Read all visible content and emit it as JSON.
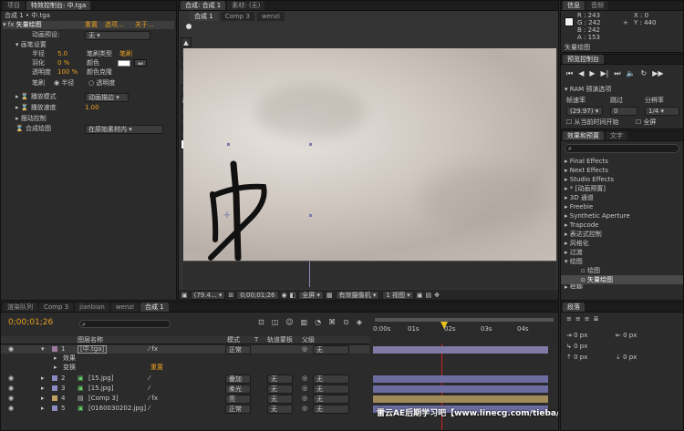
{
  "effect_controls": {
    "tabs": [
      "项目",
      "特效控制台: 中.tga"
    ],
    "header": "合成 1 • 中.tga",
    "effect_name": "矢量绘图",
    "header_buttons": [
      "重置",
      "选项...",
      "关于..."
    ],
    "preset_label": "动画预设:",
    "preset_value": "无",
    "group_brush": "画笔设置",
    "radius_label": "半径",
    "radius_value": "5.0",
    "feather_label": "羽化",
    "feather_value": "0 %",
    "opacity_label": "透明度",
    "opacity_value": "100 %",
    "brush_type_label": "笔刷类型",
    "brush_type_value": "笔刷",
    "color_label": "颜色",
    "color_clone_label": "颜色克隆",
    "brush_label": "笔刷",
    "radio_radius": "半径",
    "radio_opacity": "透明度",
    "playback_mode_label": "播放模式",
    "playback_mode_value": "动画描边",
    "playback_speed_label": "播放速度",
    "playback_speed_value": "1.00",
    "shake_label": "摆动控制",
    "composite_label": "合成绘图",
    "composite_value": "在原始素材内"
  },
  "composition": {
    "tabs": [
      "合成: 合成 1",
      "素材: (无)"
    ],
    "breadcrumbs": [
      "合成 1",
      "Comp 3",
      "wenzi"
    ],
    "zoom": "(79.4...",
    "timecode": "0;00;01;26",
    "resolution": "全屏",
    "camera": "有效摄像机",
    "views": "1 视图",
    "toolbar_value": "+0.0"
  },
  "info": {
    "tabs": [
      "信息",
      "音频"
    ],
    "r": "R : 243",
    "g": "G : 242",
    "b": "B : 242",
    "a": "A : 153",
    "x": "X : 0",
    "y": "Y : 440",
    "status": "矢量绘图"
  },
  "preview": {
    "tab": "预览控制台",
    "ram_label": "RAM 预演选项",
    "fps_label": "帧速率",
    "skip_label": "跳过",
    "res_label": "分辨率",
    "fps_value": "(29.97)",
    "skip_value": "0",
    "res_value": "1/4",
    "from_current": "从当前时间开始",
    "fullscreen": "全屏"
  },
  "effects_presets": {
    "tabs": [
      "效果和预置",
      "文字"
    ],
    "search_placeholder": "",
    "items": [
      "Final Effects",
      "Next Effects",
      "Studio Effects",
      "* [动画预置]",
      "3D 通道",
      "Freebie",
      "Synthetic Aperture",
      "Trapcode",
      "表达式控制",
      "风格化",
      "过渡",
      "绘图"
    ],
    "subitems": [
      "绘图",
      "矢量绘图"
    ],
    "cut_item": "模糊"
  },
  "paragraph": {
    "tab": "段落",
    "values": [
      "0 px",
      "0 px",
      "0 px",
      "0 px",
      "0 px"
    ]
  },
  "timeline": {
    "tabs": [
      "渲染队列",
      "Comp 3",
      "jianbian",
      "wenzi",
      "合成 1"
    ],
    "timecode": "0;00;01;26",
    "columns": [
      "图层名称",
      "模式",
      "T",
      "轨道蒙板",
      "父级"
    ],
    "ruler": [
      "0:00s",
      "01s",
      "02s",
      "03s",
      "04s"
    ],
    "layers": [
      {
        "num": "1",
        "name": "[中.tga]",
        "mode": "正常",
        "trk": "",
        "parent": "无"
      },
      {
        "num": "",
        "name": "效果",
        "mode": "",
        "trk": "",
        "parent": ""
      },
      {
        "num": "",
        "name": "变换",
        "mode": "重置",
        "trk": "",
        "parent": ""
      },
      {
        "num": "2",
        "name": "[15.jpg]",
        "mode": "叠加",
        "trk": "无",
        "parent": "无"
      },
      {
        "num": "3",
        "name": "[15.jpg]",
        "mode": "柔光",
        "trk": "无",
        "parent": "无"
      },
      {
        "num": "4",
        "name": "[Comp 3]",
        "mode": "亮",
        "trk": "无",
        "parent": "无"
      },
      {
        "num": "5",
        "name": "[0160030202.jpg]",
        "mode": "正常",
        "trk": "无",
        "parent": "无"
      }
    ],
    "mode_header": "模式"
  },
  "watermark": "雷云AE后期学习吧【www.linecg.com/tieba/1775】",
  "colors": {
    "accent": "#e8a020",
    "panel": "#2b2b2b",
    "purple": "#6c6ca0"
  }
}
